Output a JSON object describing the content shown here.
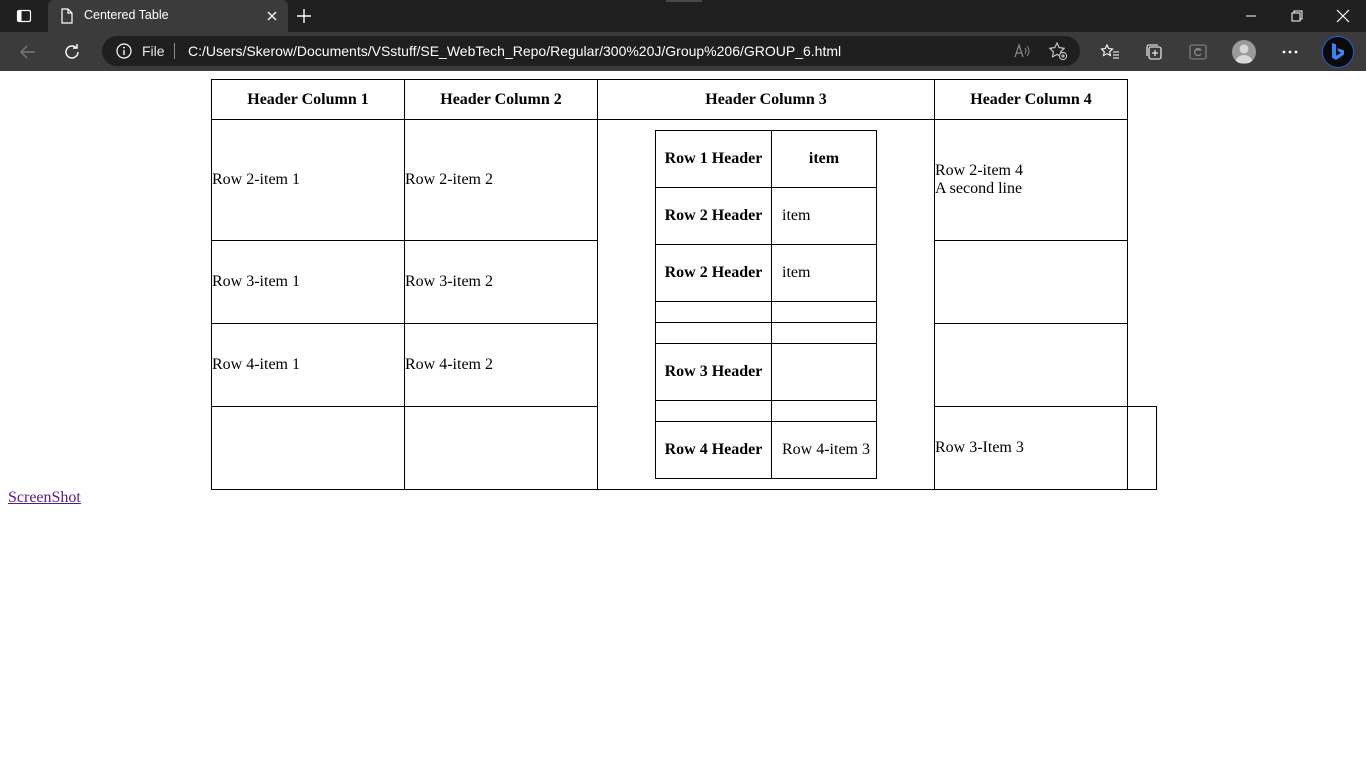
{
  "browser": {
    "tab_title": "Centered Table",
    "address_scheme": "File",
    "address_url": "C:/Users/Skerow/Documents/VSstuff/SE_WebTech_Repo/Regular/300%20J/Group%206/GROUP_6.html",
    "icons": [
      "tab-actions-icon",
      "page-icon",
      "close-icon",
      "plus-icon",
      "minimize-icon",
      "restore-icon",
      "close-window-icon",
      "back-icon",
      "refresh-icon",
      "info-icon",
      "read-aloud-icon",
      "add-favorite-icon",
      "favorites-icon",
      "collections-icon",
      "ie-mode-icon",
      "profile-icon",
      "more-icon",
      "bing-icon"
    ]
  },
  "table": {
    "headers": [
      "Header Column 1",
      "Header Column 2",
      "Header Column 3",
      "Header Column 4"
    ],
    "row2": {
      "c1": "Row 2-item 1",
      "c2": "Row 2-item 2",
      "c4_line1": "Row 2-item 4",
      "c4_line2": "A second line"
    },
    "row3": {
      "c1": "Row 3-item 1",
      "c2": "Row 3-item 2"
    },
    "row4": {
      "c1": "Row 4-item 1",
      "c2": "Row 4-item 2"
    },
    "row5": {
      "c4": "Row 3-Item 3"
    },
    "nested": {
      "r1_header": "Row 1 Header",
      "r1_value": "item",
      "r2_header": "Row 2 Header",
      "r2_value": "item",
      "r3_header": "Row 2 Header",
      "r3_value": "item",
      "r6_header": "Row 3 Header",
      "r8_header": "Row 4 Header",
      "r8_value": "Row 4-item 3"
    }
  },
  "link": {
    "label": "ScreenShot"
  }
}
